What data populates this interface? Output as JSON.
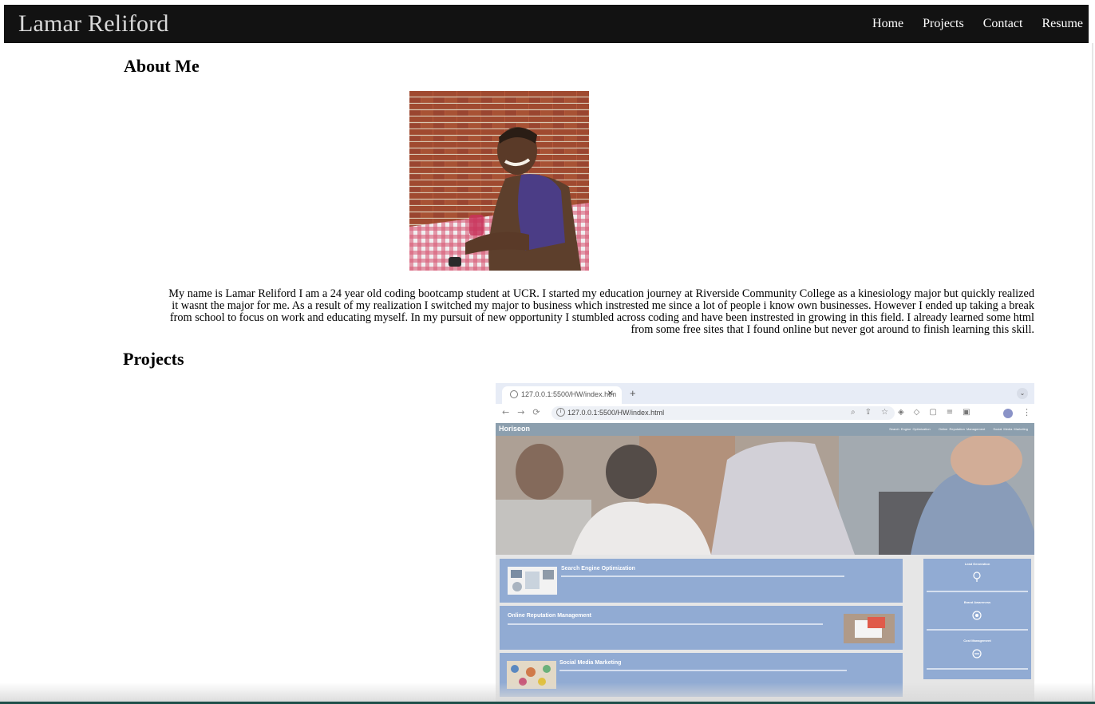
{
  "header": {
    "brand": "Lamar Reliford",
    "nav": [
      "Home",
      "Projects",
      "Contact",
      "Resume"
    ]
  },
  "about": {
    "title": "About Me",
    "text": "My name is Lamar Reliford I am a 24 year old coding bootcamp student at UCR. I started my education journey at Riverside Community College as a kinesiology major but quickly realized it wasnt the major for me. As a result of my realization I switched my major to business which instrested me since a lot of people i know own businesses. However I ended up taking a break from school to focus on work and educating myself. In my pursuit of new opportunity I stumbled across coding and have been instrested in growing in this field. I already learned some html from some free sites that I found online but never got around to finish learning this skill."
  },
  "projects": {
    "title": "Projects",
    "screenshot": {
      "tab_title": "127.0.0.1:5500/HW/index.htm",
      "url": "127.0.0.1:5500/HW/index.html",
      "site_name": "Horiseon",
      "site_nav": [
        "Search Engine Optimization",
        "Online Reputation Management",
        "Social Media Marketing"
      ],
      "cards": [
        "Search Engine Optimization",
        "Online Reputation Management",
        "Social Media Marketing"
      ],
      "aside": [
        "Lead Generation",
        "Brand Awareness",
        "Cost Management"
      ]
    }
  },
  "colors": {
    "navbar": "#121212",
    "brand_text": "#d9d9d9",
    "card_blue": "#91abd3",
    "site_header": "#8c9fae"
  }
}
